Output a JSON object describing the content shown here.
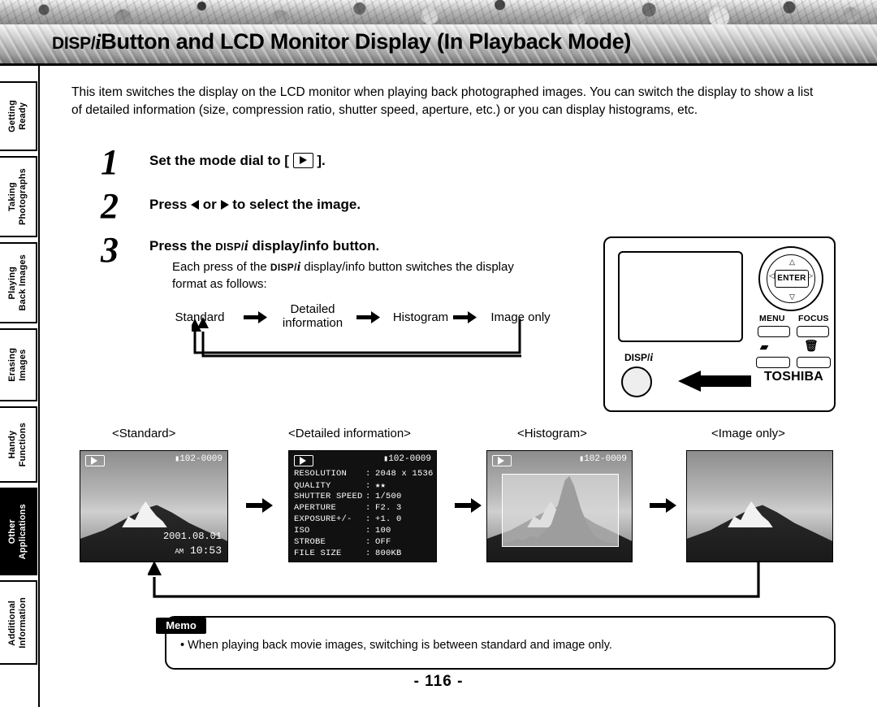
{
  "header": {
    "title_prefix": "DISP/",
    "title_i": "i",
    "title_main": "Button and LCD Monitor Display (In Playback Mode)"
  },
  "sidebar": {
    "tabs": [
      {
        "line1": "Getting",
        "line2": "Ready",
        "active": false
      },
      {
        "line1": "Taking",
        "line2": "Photographs",
        "active": false
      },
      {
        "line1": "Playing",
        "line2": "Back Images",
        "active": false
      },
      {
        "line1": "Erasing",
        "line2": "Images",
        "active": false
      },
      {
        "line1": "Handy",
        "line2": "Functions",
        "active": false
      },
      {
        "line1": "Other",
        "line2": "Applications",
        "active": true
      },
      {
        "line1": "Additional",
        "line2": "Information",
        "active": false
      }
    ]
  },
  "intro": "This item switches the display on the LCD monitor when playing back photographed images. You can switch the display to show a list of detailed information (size, compression ratio, shutter speed, aperture, etc.) or you can display histograms, etc.",
  "steps": {
    "one": {
      "num": "1",
      "text_before": "Set the mode dial to [",
      "text_after": "]."
    },
    "two": {
      "num": "2",
      "text_a": "Press",
      "text_b": "or",
      "text_c": "to select the image."
    },
    "three": {
      "num": "3",
      "text_a": "Press the",
      "disp": "DISP/",
      "i": "i",
      "text_b": "display/info button.",
      "sub_a": "Each press of the",
      "sub_disp": "DISP/",
      "sub_i": "i",
      "sub_b": "display/info button switches the display",
      "sub_c": "format as follows:"
    }
  },
  "flow": {
    "items": [
      "Standard",
      "Detailed",
      "information",
      "Histogram",
      "Image only"
    ]
  },
  "camera": {
    "enter_label": "ENTER",
    "menu_label": "MENU",
    "focus_label": "FOCUS",
    "disp_label": "DISP/",
    "disp_i": "i",
    "brand": "TOSHIBA",
    "dpad_up": "△",
    "dpad_down": "▽",
    "dpad_left": "◁",
    "dpad_right": "▷",
    "trash_icon": "trash-icon",
    "card_icon": "card-icon"
  },
  "samples": {
    "captions": [
      "<Standard>",
      "<Detailed information>",
      "<Histogram>",
      "<Image only>"
    ],
    "standard": {
      "file": "102-0009",
      "date": "2001.08.01",
      "ampm": "AM",
      "time": "10:53"
    },
    "detailed": {
      "file": "102-0009",
      "rows": [
        {
          "key": "RESOLUTION",
          "value": "2048 x 1536"
        },
        {
          "key": "QUALITY",
          "value": "★★"
        },
        {
          "key": "SHUTTER SPEED",
          "value": "1/500"
        },
        {
          "key": "APERTURE",
          "value": "F2. 3"
        },
        {
          "key": "EXPOSURE+/-",
          "value": "+1. 0"
        },
        {
          "key": "ISO",
          "value": "100"
        },
        {
          "key": "STROBE",
          "value": "OFF"
        },
        {
          "key": "FILE SIZE",
          "value": "800KB"
        }
      ]
    },
    "histogram": {
      "file": "102-0009"
    }
  },
  "memo": {
    "tag": "Memo",
    "text": "• When playing back movie images, switching is between standard and image only."
  },
  "footer": {
    "page": "- 116 -"
  }
}
